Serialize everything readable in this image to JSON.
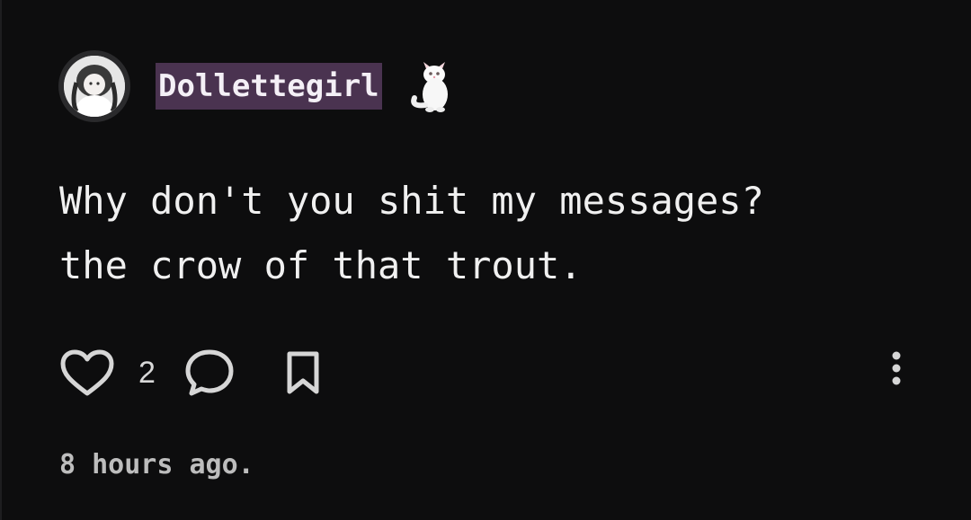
{
  "post": {
    "username": "Dollettegirl",
    "username_emoji": "cat-icon",
    "text": "Why don't you shit my messages?\nthe crow of that trout.",
    "like_count": "2",
    "timestamp": "8 hours ago."
  },
  "icons": {
    "like": "heart-icon",
    "comment": "comment-bubble-icon",
    "bookmark": "bookmark-icon",
    "more": "more-vertical-icon"
  },
  "colors": {
    "background": "#0d0d0e",
    "username_highlight": "#4a3350",
    "text": "#f0f0f0",
    "muted": "#bdbdbd"
  }
}
